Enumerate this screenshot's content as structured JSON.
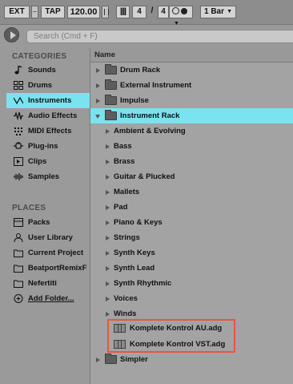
{
  "transport": {
    "ext": "EXT",
    "tap": "TAP",
    "tempo": "120.00",
    "bars_icon": "||||",
    "sig_num": "4",
    "sig_slash": "/",
    "sig_den": "4",
    "metronome_arrow": "▼",
    "quantization": "1 Bar",
    "quant_arrow": "▼"
  },
  "search": {
    "placeholder": "Search (Cmd + F)"
  },
  "sidebar": {
    "categories_title": "CATEGORIES",
    "categories": [
      {
        "label": "Sounds",
        "icon": "note-icon"
      },
      {
        "label": "Drums",
        "icon": "grid-icon"
      },
      {
        "label": "Instruments",
        "icon": "wave-icon",
        "selected": true
      },
      {
        "label": "Audio Effects",
        "icon": "audio-fx-icon"
      },
      {
        "label": "MIDI Effects",
        "icon": "midi-fx-icon"
      },
      {
        "label": "Plug-ins",
        "icon": "plug-icon"
      },
      {
        "label": "Clips",
        "icon": "clip-icon"
      },
      {
        "label": "Samples",
        "icon": "waveform-icon"
      }
    ],
    "places_title": "PLACES",
    "places": [
      {
        "label": "Packs",
        "icon": "packs-icon"
      },
      {
        "label": "User Library",
        "icon": "user-icon"
      },
      {
        "label": "Current Project",
        "icon": "folder-icon"
      },
      {
        "label": "BeatportRemixF",
        "icon": "folder-icon"
      },
      {
        "label": "Nefertiti",
        "icon": "folder-icon"
      },
      {
        "label": "Add Folder...",
        "icon": "add-icon"
      }
    ]
  },
  "browser": {
    "column_header": "Name",
    "items": [
      {
        "label": "Drum Rack",
        "type": "folder",
        "level": 0,
        "expanded": false
      },
      {
        "label": "External Instrument",
        "type": "folder",
        "level": 0,
        "expanded": false
      },
      {
        "label": "Impulse",
        "type": "folder",
        "level": 0,
        "expanded": false
      },
      {
        "label": "Instrument Rack",
        "type": "folder",
        "level": 0,
        "expanded": true,
        "selected": true
      },
      {
        "label": "Ambient & Evolving",
        "type": "category",
        "level": 1
      },
      {
        "label": "Bass",
        "type": "category",
        "level": 1
      },
      {
        "label": "Brass",
        "type": "category",
        "level": 1
      },
      {
        "label": "Guitar & Plucked",
        "type": "category",
        "level": 1
      },
      {
        "label": "Mallets",
        "type": "category",
        "level": 1
      },
      {
        "label": "Pad",
        "type": "category",
        "level": 1
      },
      {
        "label": "Piano & Keys",
        "type": "category",
        "level": 1
      },
      {
        "label": "Strings",
        "type": "category",
        "level": 1
      },
      {
        "label": "Synth Keys",
        "type": "category",
        "level": 1
      },
      {
        "label": "Synth Lead",
        "type": "category",
        "level": 1
      },
      {
        "label": "Synth Rhythmic",
        "type": "category",
        "level": 1
      },
      {
        "label": "Voices",
        "type": "category",
        "level": 1
      },
      {
        "label": "Winds",
        "type": "category",
        "level": 1
      },
      {
        "label": "Komplete Kontrol AU.adg",
        "type": "preset",
        "level": 1
      },
      {
        "label": "Komplete Kontrol VST.adg",
        "type": "preset",
        "level": 1
      },
      {
        "label": "Simpler",
        "type": "folder",
        "level": 0,
        "expanded": false
      }
    ]
  },
  "colors": {
    "selection": "#79e3f0",
    "highlight_border": "#e8563c"
  }
}
